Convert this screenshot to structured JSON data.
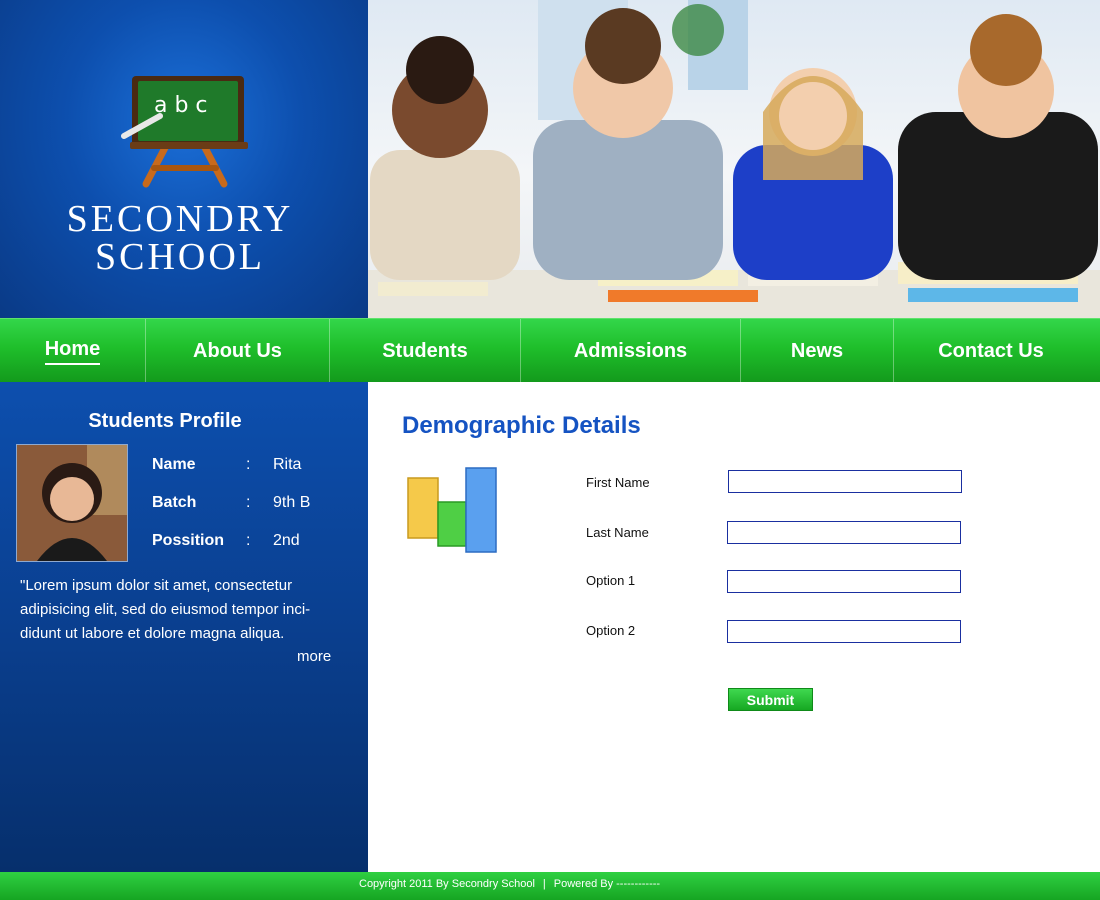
{
  "brand": {
    "name_line1": "SECONDRY",
    "name_line2": "SCHOOL",
    "logo_text": "a b c",
    "logo_icon": "chalkboard-icon"
  },
  "hero": {
    "image": "students-photo"
  },
  "nav": {
    "items": [
      {
        "label": "Home",
        "active": true
      },
      {
        "label": "About Us",
        "active": false
      },
      {
        "label": "Students",
        "active": false
      },
      {
        "label": "Admissions",
        "active": false
      },
      {
        "label": "News",
        "active": false
      },
      {
        "label": "Contact Us",
        "active": false
      }
    ]
  },
  "sidebar": {
    "title": "Students Profile",
    "profile": [
      {
        "label": "Name",
        "colon": ":",
        "value": "Rita"
      },
      {
        "label": "Batch",
        "colon": ":",
        "value": "9th B"
      },
      {
        "label": "Possition",
        "colon": ":",
        "value": "2nd"
      }
    ],
    "bio": "\"Lorem ipsum dolor sit amet, consectetur adipisicing elit, sed do eiusmod tempor inci-didunt ut labore et dolore magna aliqua.",
    "more": "more"
  },
  "content": {
    "title": "Demographic Details",
    "icon": "bar-chart-icon",
    "fields": [
      {
        "label": "First Name",
        "value": ""
      },
      {
        "label": "Last Name",
        "value": ""
      },
      {
        "label": "Option 1",
        "value": ""
      },
      {
        "label": "Option 2",
        "value": ""
      }
    ],
    "submit_label": "Submit"
  },
  "footer": {
    "copyright": "Copyright 2011 By Secondry School",
    "separator": "|",
    "powered": "Powered By ------------"
  },
  "colors": {
    "brand_blue": "#0d4fae",
    "nav_green": "#1fbf2b",
    "title_blue": "#1553c2"
  }
}
